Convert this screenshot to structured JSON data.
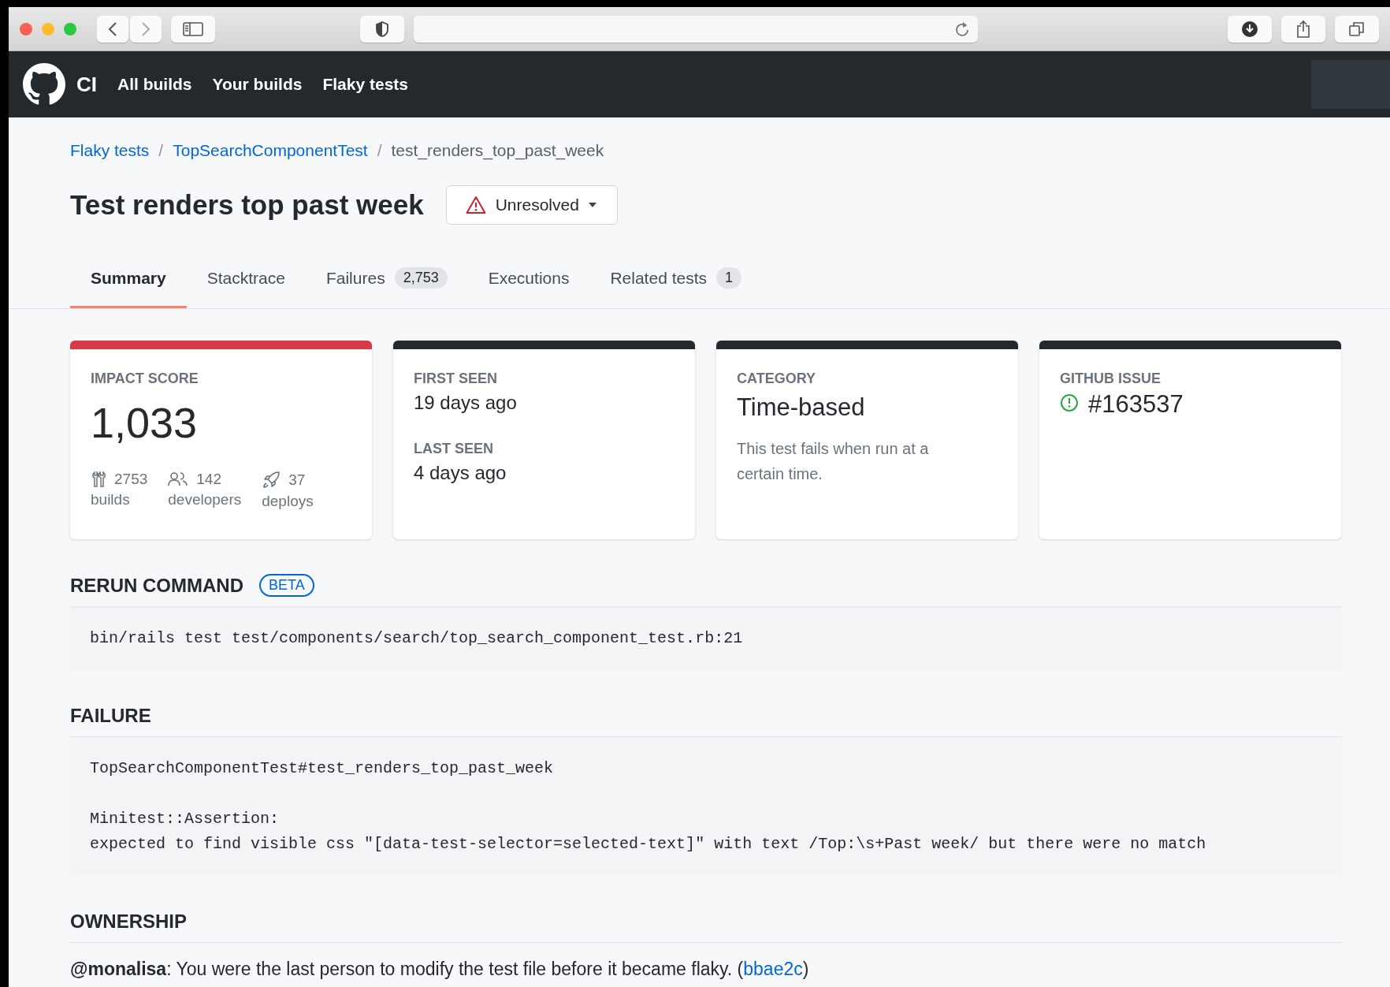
{
  "nav": {
    "brand": "CI",
    "links": [
      {
        "label": "All builds"
      },
      {
        "label": "Your builds"
      },
      {
        "label": "Flaky tests"
      }
    ]
  },
  "breadcrumb": {
    "separator": "/",
    "items": [
      {
        "label": "Flaky tests",
        "kind": "link"
      },
      {
        "label": "TopSearchComponentTest",
        "kind": "link"
      },
      {
        "label": "test_renders_top_past_week",
        "kind": "current"
      }
    ]
  },
  "title": "Test renders top past week",
  "status_button": {
    "label": "Unresolved"
  },
  "tabs": [
    {
      "label": "Summary",
      "selected": true
    },
    {
      "label": "Stacktrace",
      "selected": false
    },
    {
      "label": "Failures",
      "count": "2,753",
      "selected": false
    },
    {
      "label": "Executions",
      "selected": false
    },
    {
      "label": "Related tests",
      "count": "1",
      "selected": false
    }
  ],
  "cards": [
    {
      "kind": "score",
      "color": "#d73a49",
      "label": "IMPACT SCORE",
      "value": "1,033",
      "stats": [
        {
          "value": "2753",
          "label": "builds"
        },
        {
          "value": "142",
          "label": "developers"
        },
        {
          "value": "37",
          "label": "deploys"
        }
      ]
    },
    {
      "kind": "seen",
      "color": "#24292e",
      "entries": [
        {
          "label": "FIRST SEEN",
          "value": "19 days ago"
        },
        {
          "label": "LAST SEEN",
          "value": "4 days ago"
        }
      ]
    },
    {
      "kind": "category",
      "color": "#24292e",
      "label": "CATEGORY",
      "value": "Time-based",
      "description": "This test fails when run at a certain time."
    },
    {
      "kind": "issue",
      "color": "#24292e",
      "label": "GITHUB ISSUE",
      "value": "#163537"
    }
  ],
  "rerun": {
    "heading": "RERUN COMMAND",
    "badge": "BETA",
    "command": "bin/rails test test/components/search/top_search_component_test.rb:21"
  },
  "failure": {
    "heading": "FAILURE",
    "paragraphs": [
      {
        "lines": [
          "TopSearchComponentTest#test_renders_top_past_week"
        ]
      },
      {
        "lines": [
          "Minitest::Assertion:",
          "expected to find visible css \"[data-test-selector=selected-text]\" with text /Top:\\s+Past week/ but there were no match"
        ]
      }
    ]
  },
  "ownership": {
    "heading": "OWNERSHIP",
    "entries": [
      {
        "user": "@monalisa",
        "text": ": You were the last person to modify the test file before it became flaky. (",
        "commit": "bbae2c",
        "after": ")"
      }
    ]
  }
}
